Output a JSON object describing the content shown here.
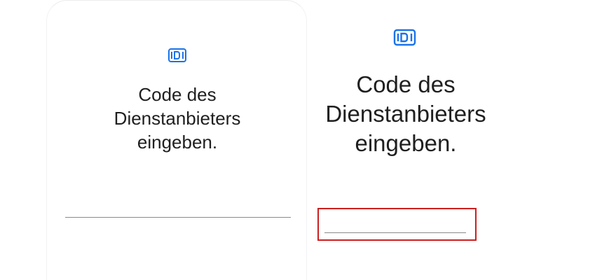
{
  "left_panel": {
    "icon": "sim-card-icon",
    "title_lines": [
      "Code des",
      "Dienstanbieters",
      "eingeben."
    ],
    "input_value": ""
  },
  "right_panel": {
    "icon": "sim-card-icon",
    "title_lines": [
      "Code des",
      "Dienstanbieters",
      "eingeben."
    ],
    "input_value": "",
    "highlight_color": "#cc1f1f"
  },
  "colors": {
    "accent": "#1a73e8",
    "text": "#1f1f1f",
    "underline": "#8a8a8a"
  }
}
